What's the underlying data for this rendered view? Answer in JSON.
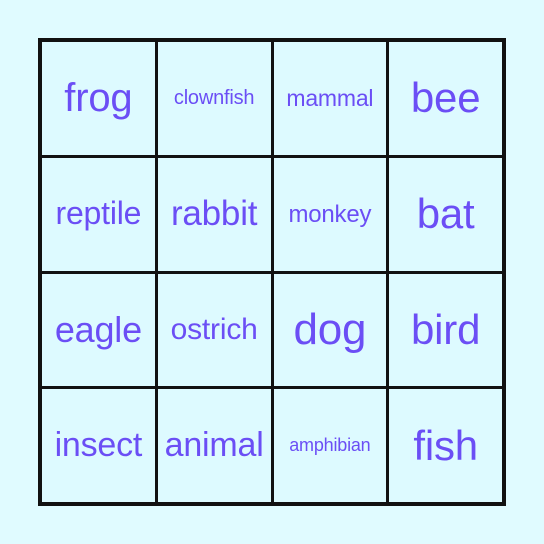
{
  "card": {
    "type": "bingo-card",
    "rows": 4,
    "columns": 4,
    "page_background_color": "#e0fbff",
    "cell_background_color": "#ddfaff",
    "grid_line_color": "#111111",
    "text_color": "#6b4ef5",
    "cells": [
      {
        "label": "frog",
        "font_size_px": 40,
        "row": 1,
        "column": 1
      },
      {
        "label": "clownfish",
        "font_size_px": 20,
        "row": 1,
        "column": 2
      },
      {
        "label": "mammal",
        "font_size_px": 23,
        "row": 1,
        "column": 3
      },
      {
        "label": "bee",
        "font_size_px": 42,
        "row": 1,
        "column": 4
      },
      {
        "label": "reptile",
        "font_size_px": 32,
        "row": 2,
        "column": 1
      },
      {
        "label": "rabbit",
        "font_size_px": 35,
        "row": 2,
        "column": 2
      },
      {
        "label": "monkey",
        "font_size_px": 24,
        "row": 2,
        "column": 3
      },
      {
        "label": "bat",
        "font_size_px": 42,
        "row": 2,
        "column": 4
      },
      {
        "label": "eagle",
        "font_size_px": 36,
        "row": 3,
        "column": 1
      },
      {
        "label": "ostrich",
        "font_size_px": 30,
        "row": 3,
        "column": 2
      },
      {
        "label": "dog",
        "font_size_px": 44,
        "row": 3,
        "column": 3
      },
      {
        "label": "bird",
        "font_size_px": 42,
        "row": 3,
        "column": 4
      },
      {
        "label": "insect",
        "font_size_px": 34,
        "row": 4,
        "column": 1
      },
      {
        "label": "animal",
        "font_size_px": 34,
        "row": 4,
        "column": 2
      },
      {
        "label": "amphibian",
        "font_size_px": 18,
        "row": 4,
        "column": 3
      },
      {
        "label": "fish",
        "font_size_px": 42,
        "row": 4,
        "column": 4
      }
    ]
  }
}
